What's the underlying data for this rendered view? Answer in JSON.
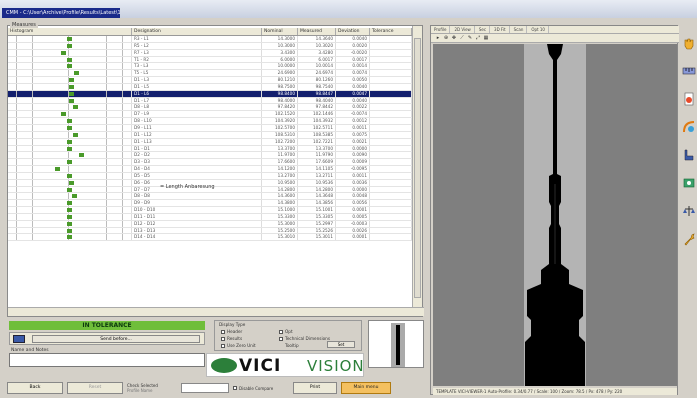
{
  "window": {
    "title": "CMM - C:\\User\\Archive\\Profile\\Results\\Latest\\1"
  },
  "grid": {
    "caption": "Measures",
    "columns": [
      "Histogram",
      "Designation",
      "Nominal",
      "Measured",
      "Deviation",
      "Tolerance"
    ],
    "rows": [
      {
        "d": "R3 - L1",
        "n": "14.3000",
        "m": "14.3640",
        "dv": "0.0040",
        "h": 0.5
      },
      {
        "d": "R5 - L2",
        "n": "10.3000",
        "m": "10.3020",
        "dv": "0.0020",
        "h": 0.5
      },
      {
        "d": "R7 - L3",
        "n": "3.4300",
        "m": "3.4280",
        "dv": "-0.0020",
        "h": 0.45
      },
      {
        "d": "T1 - R2",
        "n": "6.0000",
        "m": "6.0017",
        "dv": "0.0017",
        "h": 0.5
      },
      {
        "d": "T3 - L3",
        "n": "10.0000",
        "m": "10.0014",
        "dv": "0.0014",
        "h": 0.5
      },
      {
        "d": "T5 - L5",
        "n": "24.6900",
        "m": "24.6974",
        "dv": "0.0074",
        "h": 0.56
      },
      {
        "d": "D1 - L3",
        "n": "80.1210",
        "m": "80.1260",
        "dv": "0.0050",
        "h": 0.52
      },
      {
        "d": "D1 - L5",
        "n": "98.7500",
        "m": "98.7540",
        "dv": "0.0040",
        "h": 0.52
      },
      {
        "d": "D1 - L6",
        "n": "98.8400",
        "m": "98.8447",
        "dv": "0.0047",
        "h": 0.52
      },
      {
        "d": "D1 - L7",
        "n": "98.4000",
        "m": "98.4040",
        "dv": "0.0040",
        "h": 0.52
      },
      {
        "d": "D8 - L8",
        "n": "97.8420",
        "m": "97.8442",
        "dv": "0.0022",
        "h": 0.55
      },
      {
        "d": "D7 - L9",
        "n": "102.1520",
        "m": "102.1446",
        "dv": "-0.0074",
        "h": 0.45
      },
      {
        "d": "D8 - L10",
        "n": "104.3920",
        "m": "104.3932",
        "dv": "0.0012",
        "h": 0.5
      },
      {
        "d": "D9 - L11",
        "n": "102.5700",
        "m": "102.5711",
        "dv": "0.0011",
        "h": 0.5
      },
      {
        "d": "D1 - L12",
        "n": "108.5310",
        "m": "108.5385",
        "dv": "0.0075",
        "h": 0.55
      },
      {
        "d": "D1 - L13",
        "n": "102.7200",
        "m": "102.7221",
        "dv": "0.0021",
        "h": 0.5
      },
      {
        "d": "D1 - D1",
        "n": "13.3700",
        "m": "13.3700",
        "dv": "0.0000",
        "h": 0.5
      },
      {
        "d": "D2 - D2",
        "n": "11.9700",
        "m": "11.9790",
        "dv": "0.0090",
        "h": 0.6
      },
      {
        "d": "D3 - D3",
        "n": "17.6600",
        "m": "17.6609",
        "dv": "0.0009",
        "h": 0.5
      },
      {
        "d": "D4 - D4",
        "n": "14.1200",
        "m": "14.1105",
        "dv": "-0.0095",
        "h": 0.4
      },
      {
        "d": "D5 - D5",
        "n": "13.2700",
        "m": "13.2711",
        "dv": "0.0011",
        "h": 0.5
      },
      {
        "d": "D6 - D6",
        "n": "10.9500",
        "m": "10.9536",
        "dv": "0.0036",
        "h": 0.52
      },
      {
        "d": "D7 - D7",
        "n": "14.2800",
        "m": "14.2800",
        "dv": "0.0000",
        "h": 0.5
      },
      {
        "d": "D8 - D8",
        "n": "14.3600",
        "m": "14.3648",
        "dv": "0.0048",
        "h": 0.54
      },
      {
        "d": "D9 - D9",
        "n": "14.3800",
        "m": "14.3856",
        "dv": "0.0056",
        "h": 0.5
      },
      {
        "d": "D10 - D10",
        "n": "15.1000",
        "m": "15.1001",
        "dv": "0.0001",
        "h": 0.5
      },
      {
        "d": "D11 - D11",
        "n": "15.3300",
        "m": "15.3305",
        "dv": "0.0005",
        "h": 0.5
      },
      {
        "d": "D12 - D12",
        "n": "15.3000",
        "m": "15.2997",
        "dv": "-0.0003",
        "h": 0.5
      },
      {
        "d": "D13 - D13",
        "n": "15.2500",
        "m": "15.2526",
        "dv": "0.0026",
        "h": 0.5
      },
      {
        "d": "D14 - D14",
        "n": "15.3010",
        "m": "15.3011",
        "dv": "0.0001",
        "h": 0.5
      }
    ],
    "selected_row": 8,
    "tooltip": "= Length Anbaresung"
  },
  "tolerance": {
    "label": "IN TOLERANCE",
    "color": "#6fbe3a"
  },
  "send": {
    "button": "Send before..."
  },
  "name_field": {
    "caption": "Name and Notes",
    "value": ""
  },
  "options": {
    "group": "Display Type",
    "items": [
      "Header",
      "Results",
      "Use Zero Unit",
      "Opt",
      "Technical Dimensions",
      "Tooltip"
    ],
    "set_button": "Set"
  },
  "logo": {
    "brand": "VICI",
    "product": "VISION"
  },
  "bottom": {
    "btn_back": "Back",
    "btn_reset": "Reset",
    "field1_label": "Check Selected",
    "field1_value": "Profile Name",
    "checkbox_label": "Disable Compare",
    "btn_print": "Print",
    "btn_menu": "Main menu"
  },
  "viewer": {
    "tabs": [
      "Profile",
      "2D View",
      "Sec",
      "3D Fit",
      "Scan",
      "Opt 10"
    ],
    "tools": [
      "cursor",
      "zoom",
      "pan",
      "measure",
      "edit",
      "fit",
      "grid"
    ],
    "status": "TEMPLATE VICI-VIEWER-1 Auto-Profile: 0.34/0.77 / Scale: 100 / Zoom: 78.5 / Px: 478 / Py: 220"
  },
  "right_toolbar": {
    "icons": [
      "hand-icon",
      "ruler-icon",
      "document-icon",
      "calibrate-icon",
      "profile-icon",
      "machine-icon",
      "balance-icon",
      "wrench-icon"
    ]
  }
}
